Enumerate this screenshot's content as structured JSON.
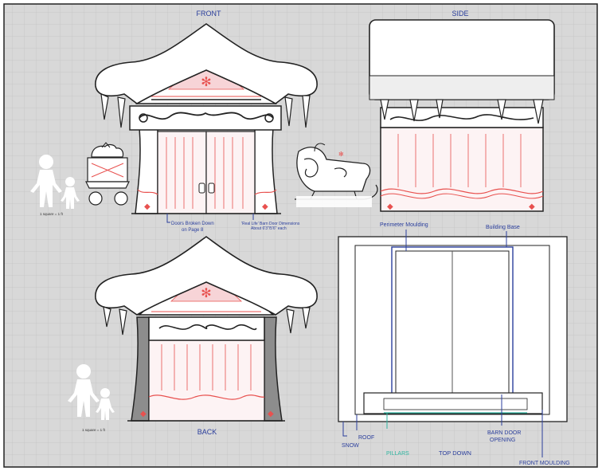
{
  "views": {
    "front": "FRONT",
    "side": "SIDE",
    "back": "BACK",
    "top_down": "TOP DOWN"
  },
  "notes": {
    "doors_line1": "Doors Broken Down",
    "doors_line2": "on Page 8",
    "real_life_line1": "'Real Life' Barn Door Dimensions",
    "real_life_line2": "About 6'3\"/5'6\" each",
    "scale_front": "1 square = 1 ft",
    "scale_back": "1 square = 1 ft"
  },
  "top_down_labels": {
    "perimeter_moulding": "Perimeter Moulding",
    "building_base": "Building Base",
    "snow": "SNOW",
    "roof": "ROOF",
    "pillars": "PILLARS",
    "barn_door_line1": "BARN DOOR",
    "barn_door_line2": "OPENING",
    "front_moulding": "FRONT MOULDING"
  },
  "colors": {
    "grid_bg": "#d6d6d6",
    "grid_line": "#c2c2c2",
    "outline": "#2a2a2a",
    "accent_red": "#e8514f",
    "pink": "#f6d3d6",
    "label_blue": "#2a3e9c",
    "pillars_teal": "#2fb5a0",
    "pillar_gray": "#8d8d8d"
  }
}
